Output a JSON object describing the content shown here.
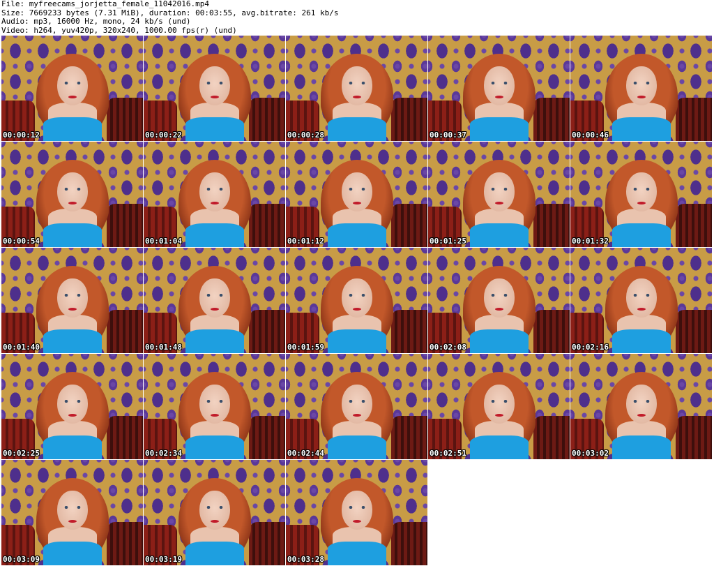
{
  "header": {
    "lines": [
      "File: myfreecams_jorjetta_female_11042016.mp4",
      "Size: 7669233 bytes (7.31 MiB), duration: 00:03:55, avg.bitrate: 261 kb/s",
      "Audio: mp3, 16000 Hz, mono, 24 kb/s (und)",
      "Video: h264, yuv420p, 320x240, 1000.00 fps(r) (und)"
    ]
  },
  "thumbnails": [
    {
      "timestamp": "00:00:12"
    },
    {
      "timestamp": "00:00:22"
    },
    {
      "timestamp": "00:00:28"
    },
    {
      "timestamp": "00:00:37"
    },
    {
      "timestamp": "00:00:46"
    },
    {
      "timestamp": "00:00:54"
    },
    {
      "timestamp": "00:01:04"
    },
    {
      "timestamp": "00:01:12"
    },
    {
      "timestamp": "00:01:25"
    },
    {
      "timestamp": "00:01:32"
    },
    {
      "timestamp": "00:01:40"
    },
    {
      "timestamp": "00:01:48"
    },
    {
      "timestamp": "00:01:59"
    },
    {
      "timestamp": "00:02:08"
    },
    {
      "timestamp": "00:02:16"
    },
    {
      "timestamp": "00:02:25"
    },
    {
      "timestamp": "00:02:34"
    },
    {
      "timestamp": "00:02:44"
    },
    {
      "timestamp": "00:02:51"
    },
    {
      "timestamp": "00:03:02"
    },
    {
      "timestamp": "00:03:09"
    },
    {
      "timestamp": "00:03:19"
    },
    {
      "timestamp": "00:03:28"
    }
  ],
  "colors": {
    "wallpaper": "#c89c46",
    "damask": "#4e2f8c",
    "top": "#1e9fe0",
    "hair": "#c2582a"
  }
}
